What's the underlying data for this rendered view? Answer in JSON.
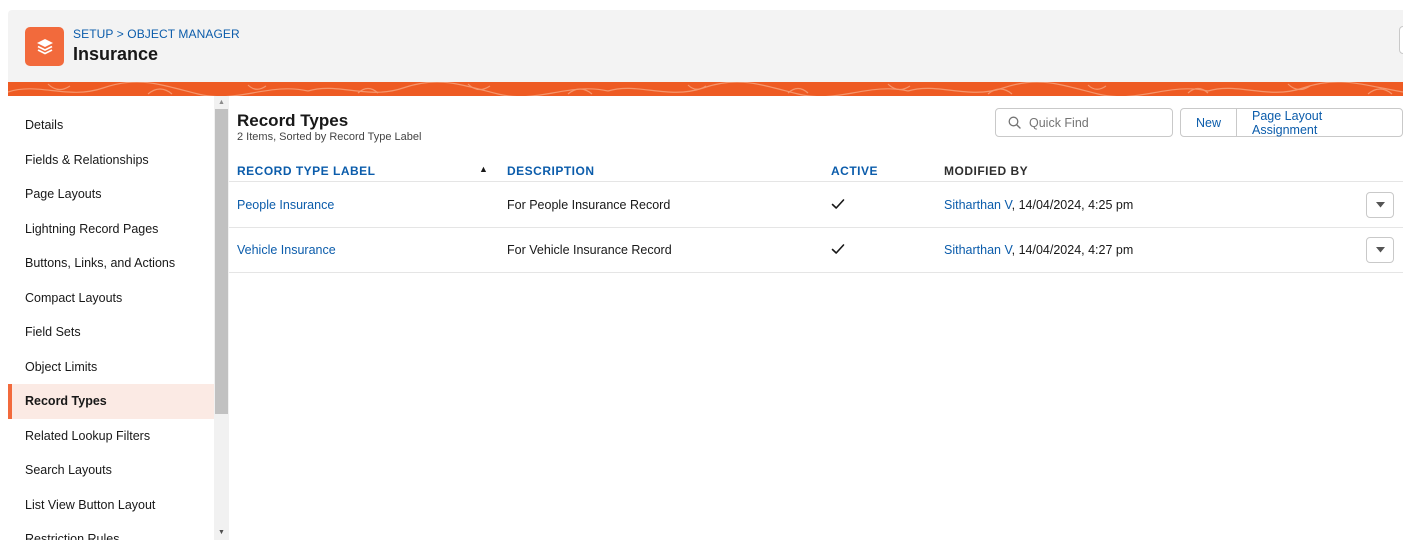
{
  "header": {
    "breadcrumb": "SETUP > OBJECT MANAGER",
    "title": "Insurance",
    "icon": "layers-icon",
    "brand_color": "#f26a3c"
  },
  "sidebar": {
    "items": [
      {
        "label": "Details"
      },
      {
        "label": "Fields & Relationships"
      },
      {
        "label": "Page Layouts"
      },
      {
        "label": "Lightning Record Pages"
      },
      {
        "label": "Buttons, Links, and Actions"
      },
      {
        "label": "Compact Layouts"
      },
      {
        "label": "Field Sets"
      },
      {
        "label": "Object Limits"
      },
      {
        "label": "Record Types",
        "active": true
      },
      {
        "label": "Related Lookup Filters"
      },
      {
        "label": "Search Layouts"
      },
      {
        "label": "List View Button Layout"
      },
      {
        "label": "Restriction Rules"
      }
    ]
  },
  "main": {
    "title": "Record Types",
    "subtitle": "2 Items, Sorted by Record Type Label",
    "quick_find_placeholder": "Quick Find",
    "new_label": "New",
    "page_layout_label": "Page Layout Assignment",
    "columns": [
      "RECORD TYPE LABEL",
      "DESCRIPTION",
      "ACTIVE",
      "MODIFIED BY"
    ],
    "rows": [
      {
        "label": "People Insurance",
        "description": "For People Insurance Record",
        "active": true,
        "modified_user": "Sitharthan V",
        "modified_date": ", 14/04/2024, 4:25 pm"
      },
      {
        "label": "Vehicle Insurance",
        "description": "For Vehicle Insurance Record",
        "active": true,
        "modified_user": "Sitharthan V",
        "modified_date": ", 14/04/2024, 4:27 pm"
      }
    ]
  }
}
